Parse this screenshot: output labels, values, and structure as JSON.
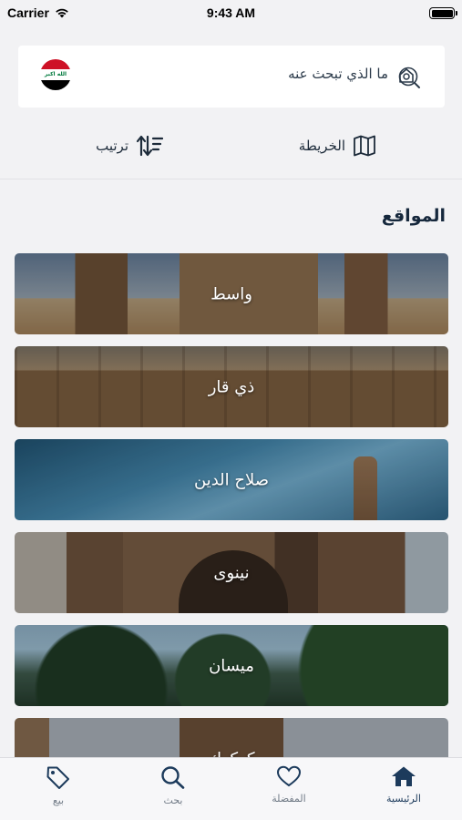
{
  "status_bar": {
    "carrier": "Carrier",
    "time": "9:43 AM"
  },
  "search": {
    "placeholder": "ما الذي تبحث عنه",
    "flag_text": "الله اكبر"
  },
  "tools": {
    "map_label": "الخريطة",
    "sort_label": "ترتيب"
  },
  "section": {
    "title": "المواقع"
  },
  "places": [
    {
      "name": "واسط"
    },
    {
      "name": "ذي قار"
    },
    {
      "name": "صلاح الدين"
    },
    {
      "name": "نينوى"
    },
    {
      "name": "ميسان"
    },
    {
      "name": "كركوك"
    }
  ],
  "tabs": [
    {
      "label": "الرئيسية",
      "icon": "home-icon"
    },
    {
      "label": "المفضلة",
      "icon": "heart-icon"
    },
    {
      "label": "بحث",
      "icon": "search-icon"
    },
    {
      "label": "بيع",
      "icon": "tag-icon"
    }
  ],
  "colors": {
    "accent": "#1d3b5c",
    "tab_inactive": "#707a86"
  }
}
